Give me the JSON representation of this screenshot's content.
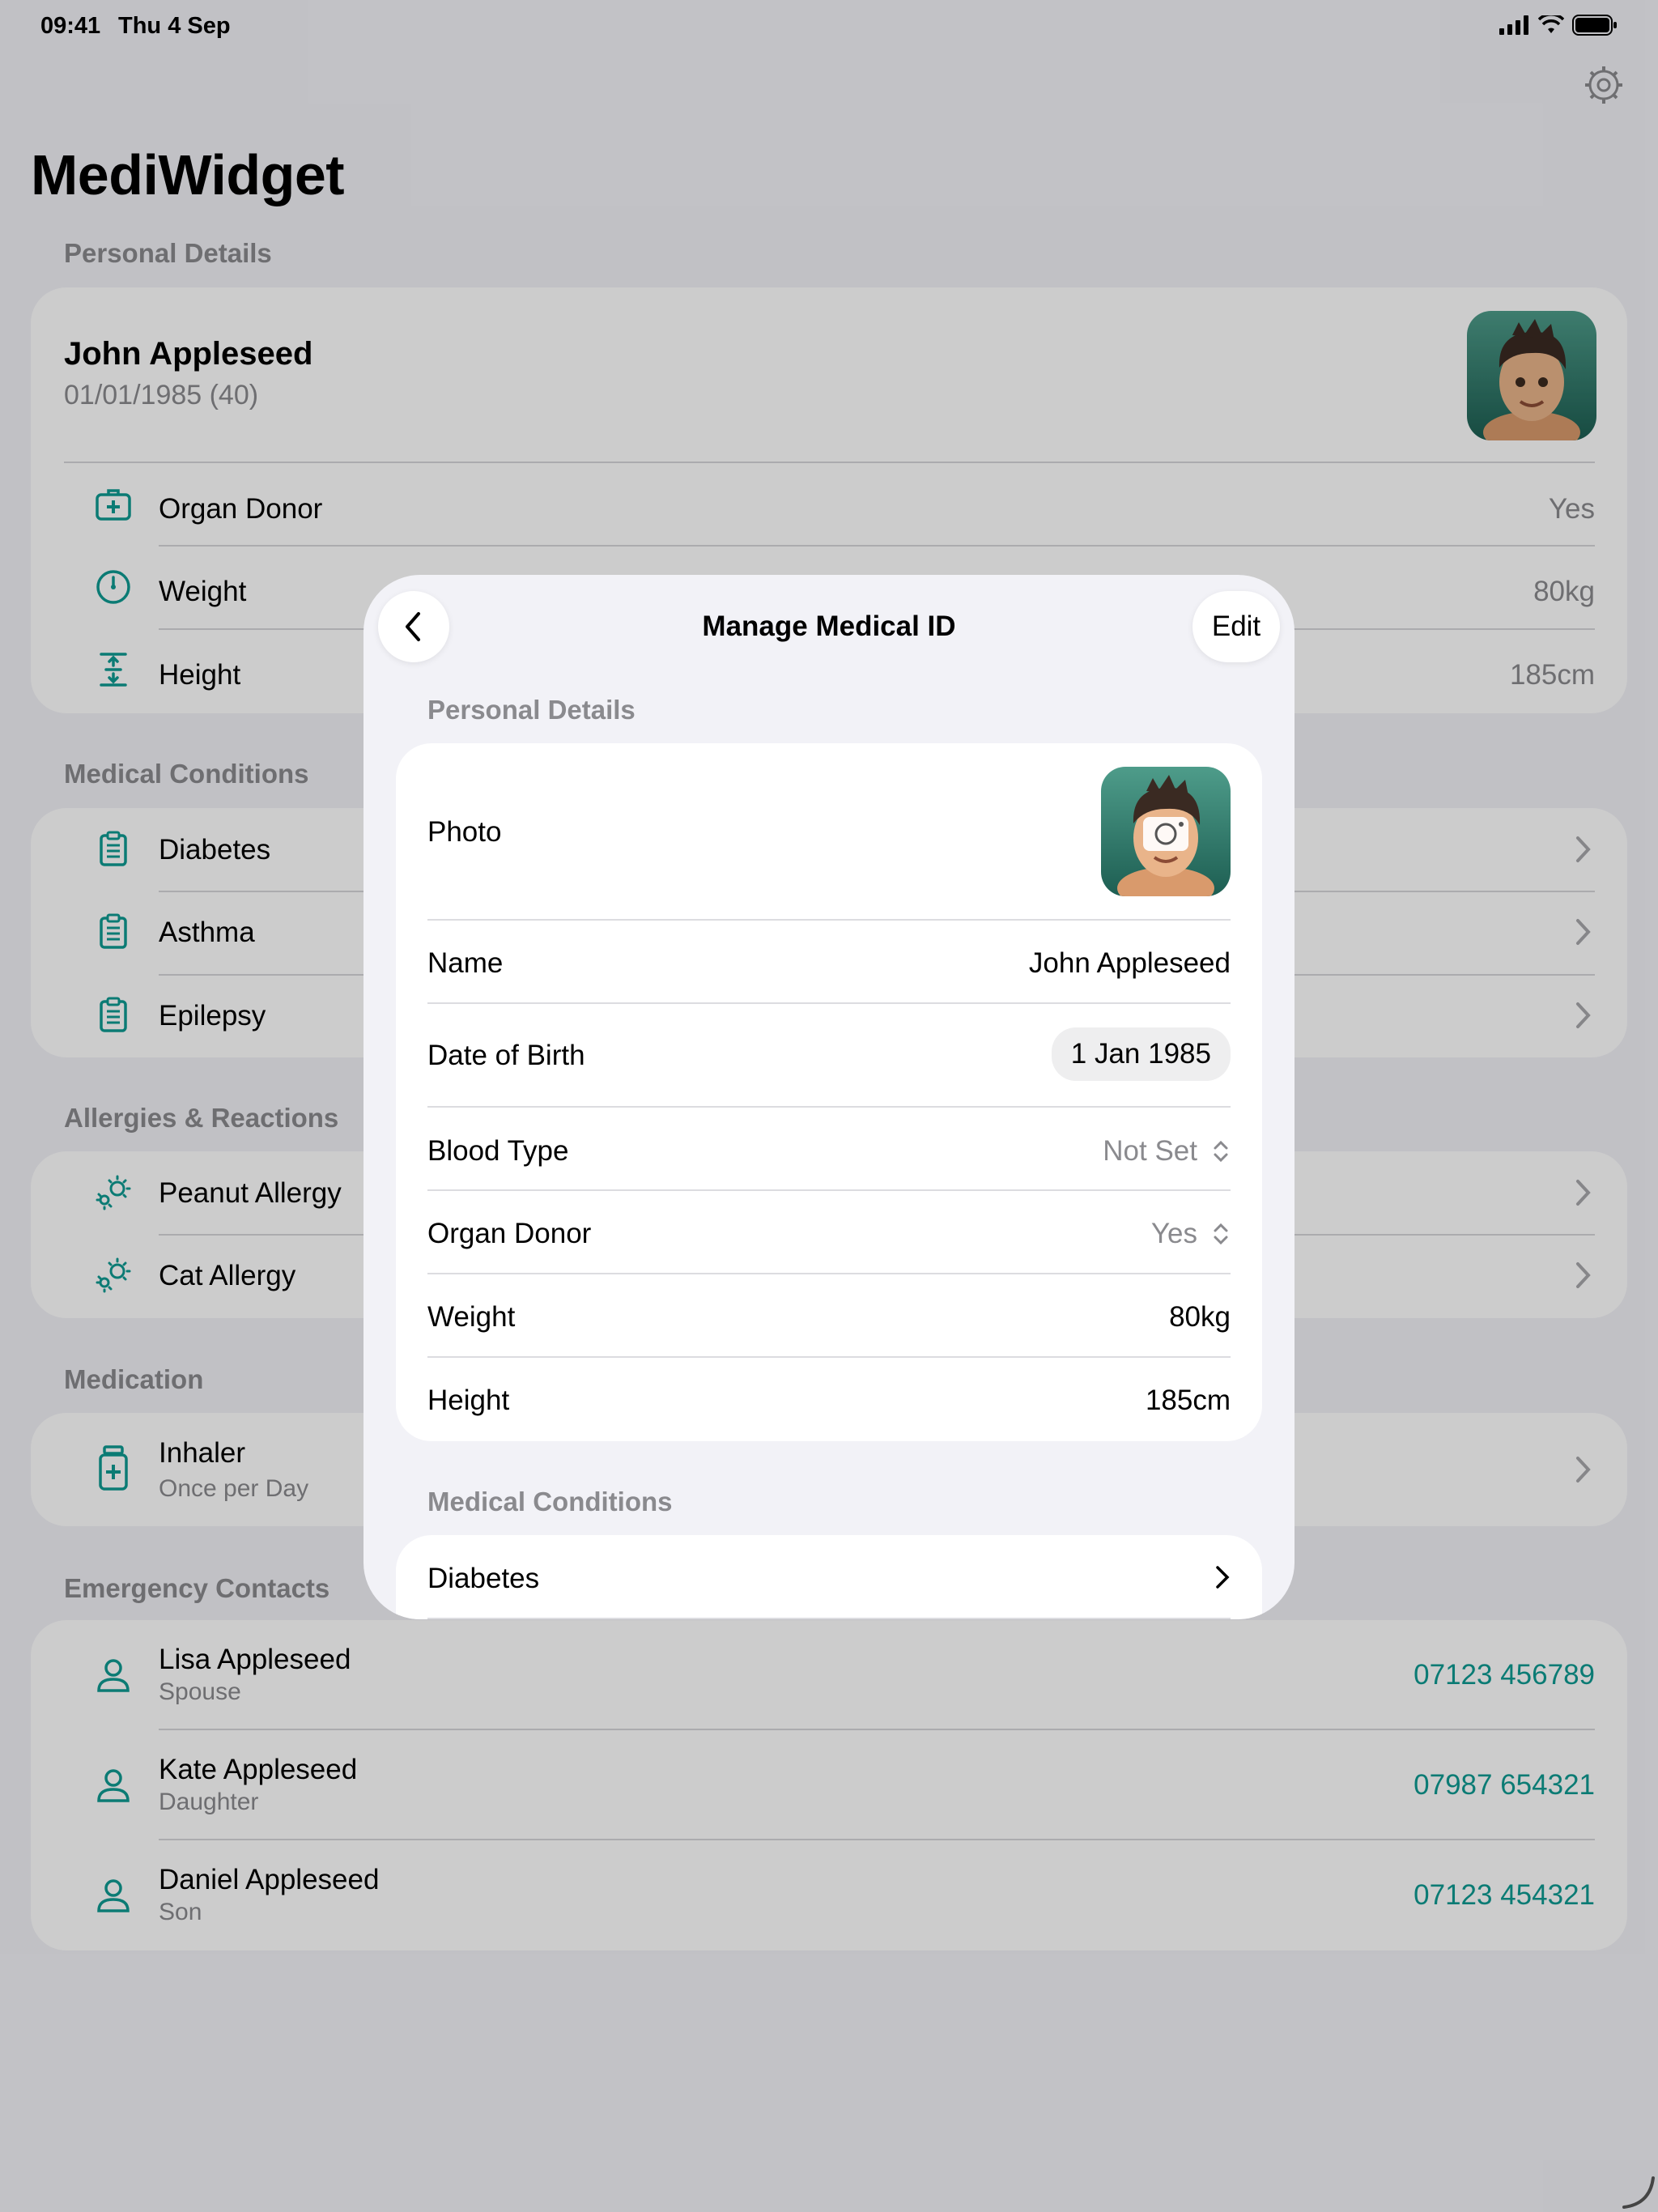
{
  "status": {
    "time": "09:41",
    "date": "Thu 4 Sep"
  },
  "app": {
    "title": "MediWidget"
  },
  "personal": {
    "header": "Personal Details",
    "name": "John Appleseed",
    "dob": "01/01/1985 (40)",
    "rows": [
      {
        "label": "Organ Donor",
        "value": "Yes",
        "icon": "medkit-icon"
      },
      {
        "label": "Weight",
        "value": "80kg",
        "icon": "gauge-icon"
      },
      {
        "label": "Height",
        "value": "185cm",
        "icon": "height-icon"
      }
    ]
  },
  "conditions": {
    "header": "Medical Conditions",
    "items": [
      {
        "label": "Diabetes"
      },
      {
        "label": "Asthma"
      },
      {
        "label": "Epilepsy"
      }
    ]
  },
  "allergies": {
    "header": "Allergies & Reactions",
    "items": [
      {
        "label": "Peanut Allergy"
      },
      {
        "label": "Cat Allergy"
      }
    ]
  },
  "medication": {
    "header": "Medication",
    "items": [
      {
        "label": "Inhaler",
        "sub": "Once per Day"
      }
    ]
  },
  "contacts": {
    "header": "Emergency Contacts",
    "items": [
      {
        "name": "Lisa Appleseed",
        "relation": "Spouse",
        "phone": "07123 456789"
      },
      {
        "name": "Kate Appleseed",
        "relation": "Daughter",
        "phone": "07987 654321"
      },
      {
        "name": "Daniel Appleseed",
        "relation": "Son",
        "phone": "07123 454321"
      }
    ]
  },
  "modal": {
    "title": "Manage Medical ID",
    "edit_label": "Edit",
    "personal_header": "Personal Details",
    "photo_label": "Photo",
    "name_label": "Name",
    "name_value": "John Appleseed",
    "dob_label": "Date of Birth",
    "dob_value": "1 Jan 1985",
    "blood_label": "Blood Type",
    "blood_value": "Not Set",
    "donor_label": "Organ Donor",
    "donor_value": "Yes",
    "weight_label": "Weight",
    "weight_value": "80kg",
    "height_label": "Height",
    "height_value": "185cm",
    "conditions_header": "Medical Conditions",
    "condition_first": "Diabetes"
  },
  "colors": {
    "accent": "#0e9a92",
    "background": "#f2f2f7"
  }
}
